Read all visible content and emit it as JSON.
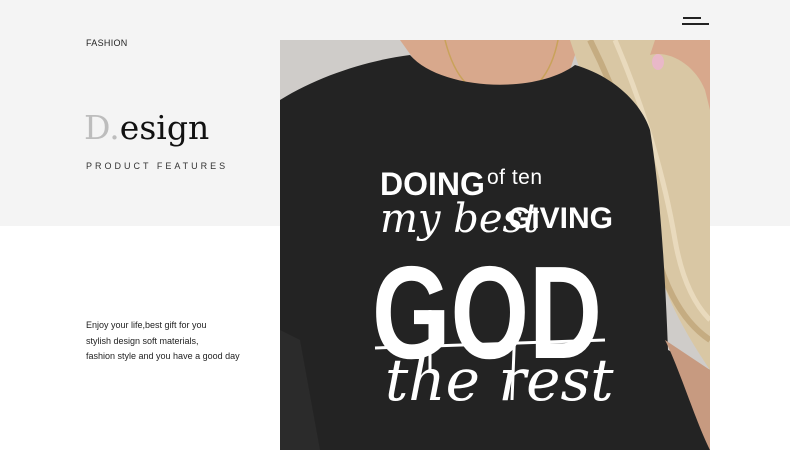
{
  "header": {
    "category": "FASHION",
    "menu_icon": "menu-icon"
  },
  "hero": {
    "title_initial": "D",
    "title_dot": ".",
    "title_rest": "esign",
    "subtitle": "PRODUCT FEATURES"
  },
  "description": {
    "lines": [
      "Enjoy your life,best gift for you",
      "stylish design soft materials,",
      "fashion style and you have a good day"
    ]
  },
  "product_image": {
    "print": {
      "doing": "DOING",
      "my_best": "my best",
      "giving": "GIVING",
      "god": "GOD",
      "the_rest": "the rest"
    },
    "overlay_text": "of ten"
  },
  "colors": {
    "top_band": "#f4f4f4",
    "shirt": "#222222",
    "print": "#ffffff"
  }
}
